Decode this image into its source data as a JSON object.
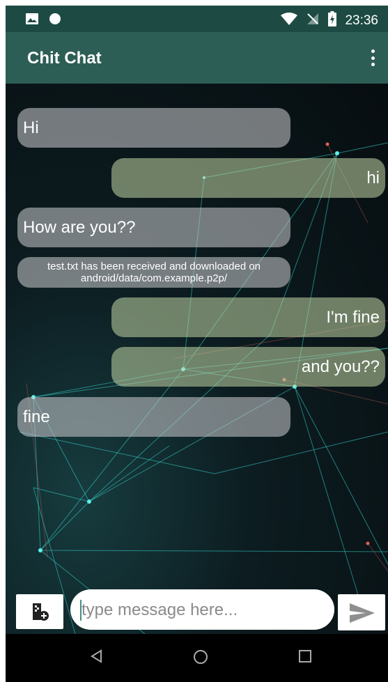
{
  "status_bar": {
    "time": "23:36",
    "left_icons": [
      "image-icon",
      "circle-icon"
    ],
    "right_icons": [
      "wifi-icon",
      "no-sim-icon",
      "battery-charging-icon"
    ]
  },
  "app_bar": {
    "title": "Chit Chat",
    "menu_icon": "more-vert-icon"
  },
  "messages": [
    {
      "direction": "incoming",
      "text": "Hi"
    },
    {
      "direction": "outgoing",
      "text": "hi"
    },
    {
      "direction": "incoming",
      "text": "How are you??"
    },
    {
      "direction": "incoming",
      "text": "test.txt has been received and downloaded on android/data/com.example.p2p/"
    },
    {
      "direction": "outgoing",
      "text": "I'm fine"
    },
    {
      "direction": "outgoing",
      "text": "and you??"
    },
    {
      "direction": "incoming",
      "text": "fine"
    }
  ],
  "composer": {
    "attach_icon": "attach-file-icon",
    "placeholder": "type message here...",
    "value": "",
    "send_icon": "send-icon"
  },
  "nav_bar": {
    "icons": [
      "back-icon",
      "home-icon",
      "recents-icon"
    ]
  },
  "colors": {
    "status_bar": "#1e4a44",
    "app_bar": "#2d5e56",
    "incoming_bubble": "#cdcdd2",
    "outgoing_bubble": "#c3d7a5",
    "network_lines": "#37d6cf"
  }
}
